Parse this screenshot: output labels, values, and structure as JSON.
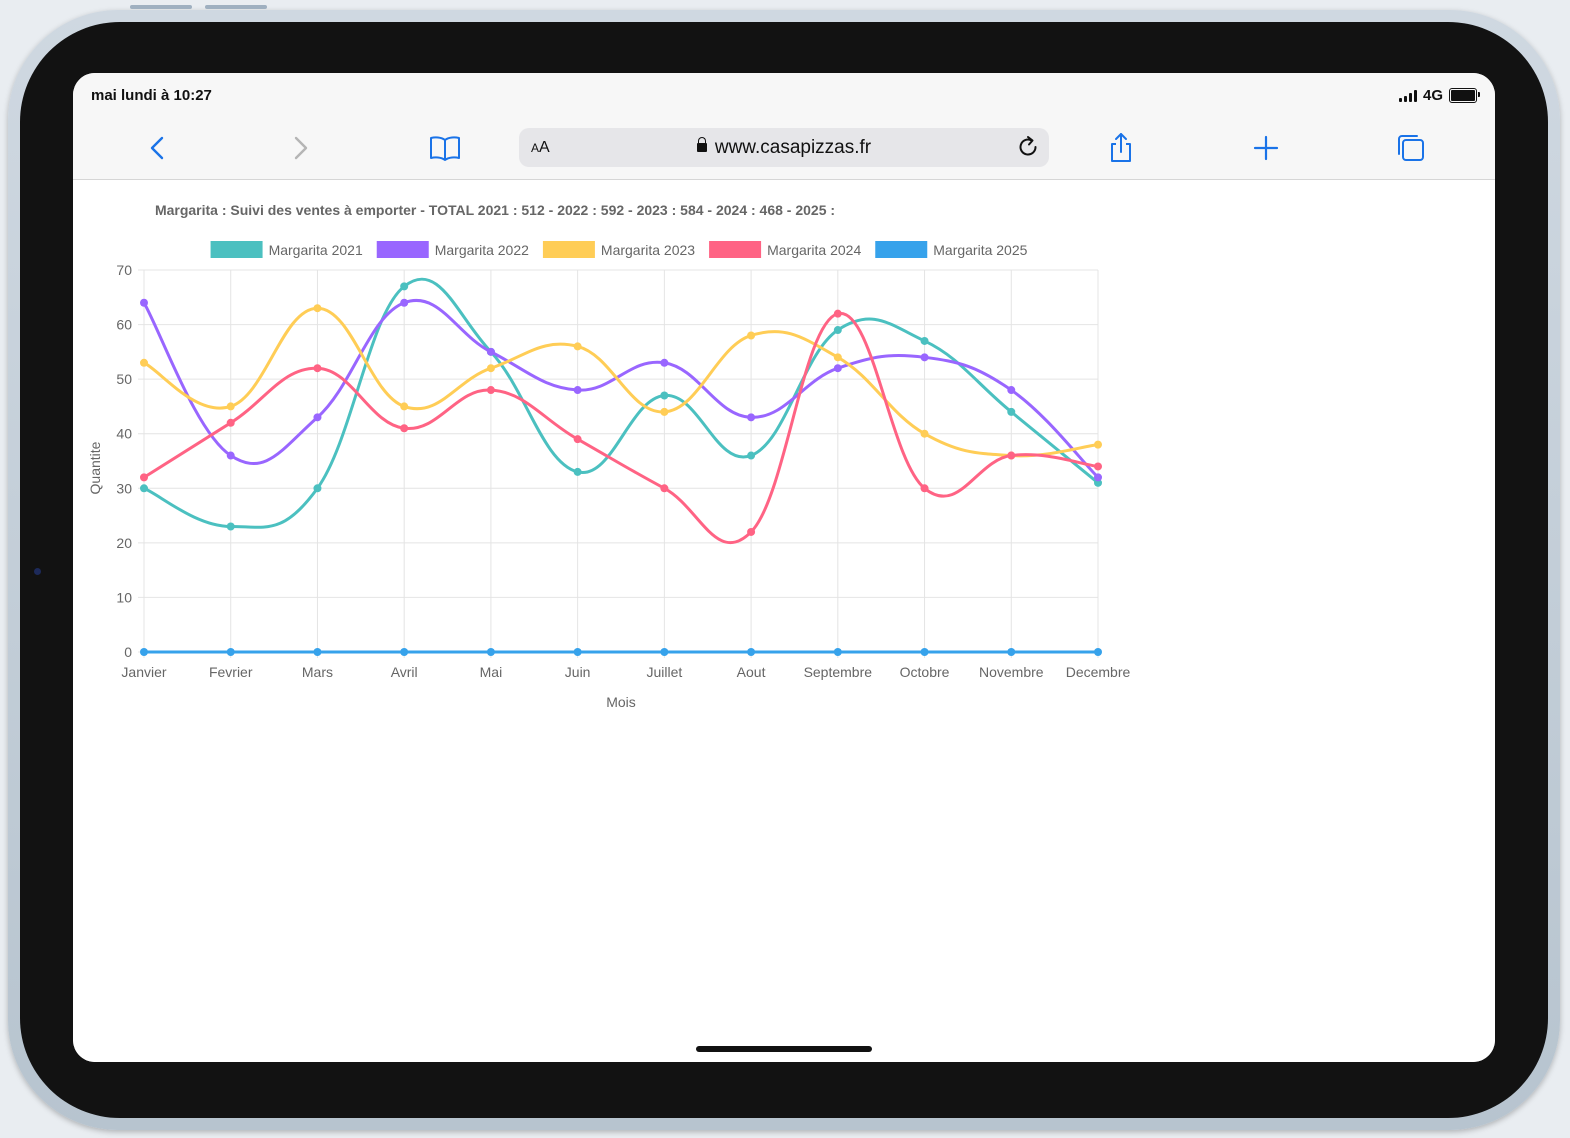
{
  "status_bar": {
    "time": "mai lundi à 10:27",
    "network": "4G"
  },
  "browser": {
    "aa_label_small": "A",
    "aa_label_large": "A",
    "url": "www.casapizzas.fr"
  },
  "chart_data": {
    "type": "line",
    "title": "Margarita : Suivi des ventes à emporter - TOTAL 2021 : 512 - 2022 : 592 - 2023 : 584 - 2024 : 468 - 2025 :",
    "xlabel": "Mois",
    "ylabel": "Quantite",
    "ylim": [
      0,
      70
    ],
    "yticks": [
      0,
      10,
      20,
      30,
      40,
      50,
      60,
      70
    ],
    "grid": true,
    "legend_position": "top",
    "categories": [
      "Janvier",
      "Fevrier",
      "Mars",
      "Avril",
      "Mai",
      "Juin",
      "Juillet",
      "Aout",
      "Septembre",
      "Octobre",
      "Novembre",
      "Decembre"
    ],
    "series": [
      {
        "name": "Margarita 2021",
        "color": "#4bc0c0",
        "values": [
          30,
          23,
          30,
          67,
          55,
          33,
          47,
          36,
          59,
          57,
          44,
          31
        ]
      },
      {
        "name": "Margarita 2022",
        "color": "#9966ff",
        "values": [
          64,
          36,
          43,
          64,
          55,
          48,
          53,
          43,
          52,
          54,
          48,
          32
        ]
      },
      {
        "name": "Margarita 2023",
        "color": "#ffcd56",
        "values": [
          53,
          45,
          63,
          45,
          52,
          56,
          44,
          58,
          54,
          40,
          36,
          38
        ]
      },
      {
        "name": "Margarita 2024",
        "color": "#ff6384",
        "values": [
          32,
          42,
          52,
          41,
          48,
          39,
          30,
          22,
          62,
          30,
          36,
          34
        ]
      },
      {
        "name": "Margarita 2025",
        "color": "#36a2eb",
        "values": [
          0,
          0,
          0,
          0,
          0,
          0,
          0,
          0,
          0,
          0,
          0,
          0
        ]
      }
    ]
  }
}
